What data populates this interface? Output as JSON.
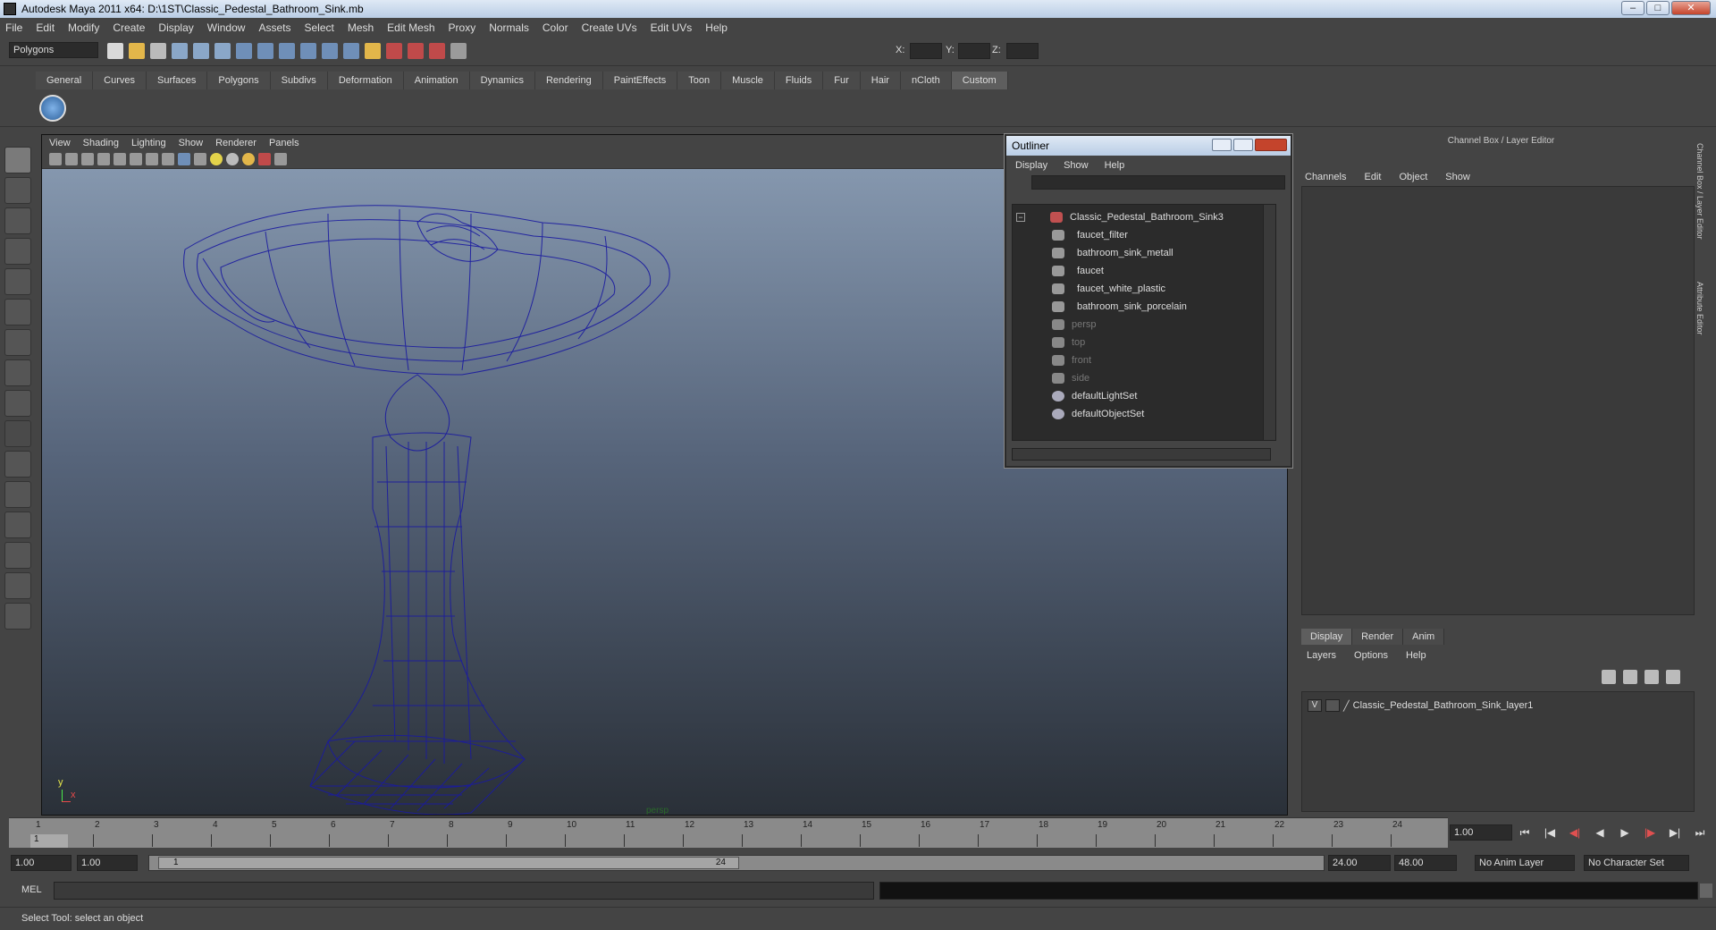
{
  "window": {
    "title": "Autodesk Maya 2011 x64: D:\\1ST\\Classic_Pedestal_Bathroom_Sink.mb",
    "min": "–",
    "max": "□",
    "close": "✕"
  },
  "menubar": [
    "File",
    "Edit",
    "Modify",
    "Create",
    "Display",
    "Window",
    "Assets",
    "Select",
    "Mesh",
    "Edit Mesh",
    "Proxy",
    "Normals",
    "Color",
    "Create UVs",
    "Edit UVs",
    "Help"
  ],
  "status": {
    "mode": "Polygons",
    "x_label": "X:",
    "y_label": "Y:",
    "z_label": "Z:"
  },
  "shelf_tabs": [
    "General",
    "Curves",
    "Surfaces",
    "Polygons",
    "Subdivs",
    "Deformation",
    "Animation",
    "Dynamics",
    "Rendering",
    "PaintEffects",
    "Toon",
    "Muscle",
    "Fluids",
    "Fur",
    "Hair",
    "nCloth",
    "Custom"
  ],
  "shelf_active": "Custom",
  "viewport": {
    "menu": [
      "View",
      "Shading",
      "Lighting",
      "Show",
      "Renderer",
      "Panels"
    ],
    "camera_label": "persp",
    "axis_x": "x",
    "axis_y": "y"
  },
  "outliner": {
    "title": "Outliner",
    "menu": [
      "Display",
      "Show",
      "Help"
    ],
    "items": [
      {
        "label": "Classic_Pedestal_Bathroom_Sink3",
        "dim": false
      },
      {
        "label": "faucet_filter",
        "dim": false
      },
      {
        "label": "bathroom_sink_metall",
        "dim": false
      },
      {
        "label": "faucet",
        "dim": false
      },
      {
        "label": "faucet_white_plastic",
        "dim": false
      },
      {
        "label": "bathroom_sink_porcelain",
        "dim": false
      },
      {
        "label": "persp",
        "dim": true
      },
      {
        "label": "top",
        "dim": true
      },
      {
        "label": "front",
        "dim": true
      },
      {
        "label": "side",
        "dim": true
      },
      {
        "label": "defaultLightSet",
        "dim": false
      },
      {
        "label": "defaultObjectSet",
        "dim": false
      }
    ]
  },
  "channelbox": {
    "title": "Channel Box / Layer Editor",
    "menu": [
      "Channels",
      "Edit",
      "Object",
      "Show"
    ],
    "side_tabs": [
      "Channel Box / Layer Editor",
      "Attribute Editor"
    ]
  },
  "layers": {
    "tabs": [
      "Display",
      "Render",
      "Anim"
    ],
    "active": "Display",
    "menu": [
      "Layers",
      "Options",
      "Help"
    ],
    "layer_name": "Classic_Pedestal_Bathroom_Sink_layer1",
    "visible": "V"
  },
  "timeline": {
    "ticks": [
      "1",
      "2",
      "3",
      "4",
      "5",
      "6",
      "7",
      "8",
      "9",
      "10",
      "11",
      "12",
      "13",
      "14",
      "15",
      "16",
      "17",
      "18",
      "19",
      "20",
      "21",
      "22",
      "23",
      "24"
    ],
    "current_marker": "1",
    "current_frame": "1.00"
  },
  "range": {
    "start": "1.00",
    "start2": "1.00",
    "handle_start": "1",
    "handle_end": "24",
    "end": "24.00",
    "end2": "48.00",
    "anim_layer": "No Anim Layer",
    "char_set": "No Character Set"
  },
  "cmd": {
    "label": "MEL"
  },
  "statusbar": {
    "text": "Select Tool: select an object"
  }
}
